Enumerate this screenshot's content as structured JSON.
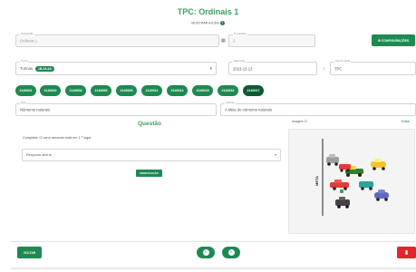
{
  "header": {
    "title": "TPC: Ordinais 1",
    "subtitle": "MOSTRAR AJUDA",
    "help_icon": "help-circle-icon"
  },
  "fields": {
    "field1": {
      "label": "Designação",
      "value": "Ordinais 1"
    },
    "field2": {
      "label": "Nº questões",
      "value": "2"
    },
    "turma": {
      "label": "Turma",
      "prefix": "Turmas",
      "tag": "1B-2A-4A"
    },
    "data": {
      "label": "Data limite",
      "value": "2023-12-13"
    },
    "tipo": {
      "label": "Tipo de tarefa",
      "value": "TPC"
    },
    "area": {
      "label": "Área",
      "value": "Números naturais"
    },
    "subarea": {
      "label": "Subárea",
      "value": "A ideia de números naturais"
    }
  },
  "buttons": {
    "config": "CONFIGURAÇÕES",
    "verify": "VERIFICAÇÃO",
    "back": "VOLTAR"
  },
  "chips": [
    "2140001",
    "2140002",
    "2140003",
    "2140005",
    "2140009",
    "2140011",
    "2140014",
    "2140015",
    "2140016",
    "2140017"
  ],
  "active_chip_index": 9,
  "question": {
    "heading": "Questão",
    "instruction": "Completa: O carro amarelo está em 1.º lugar.",
    "answer_value": "Resposta aberta",
    "image_header_left": "Imagem 17",
    "image_header_right": "Editar",
    "axis_label": "META"
  },
  "colors": {
    "primary": "#1e8a52",
    "title_green": "#3aa35b",
    "danger": "#e4252b"
  }
}
